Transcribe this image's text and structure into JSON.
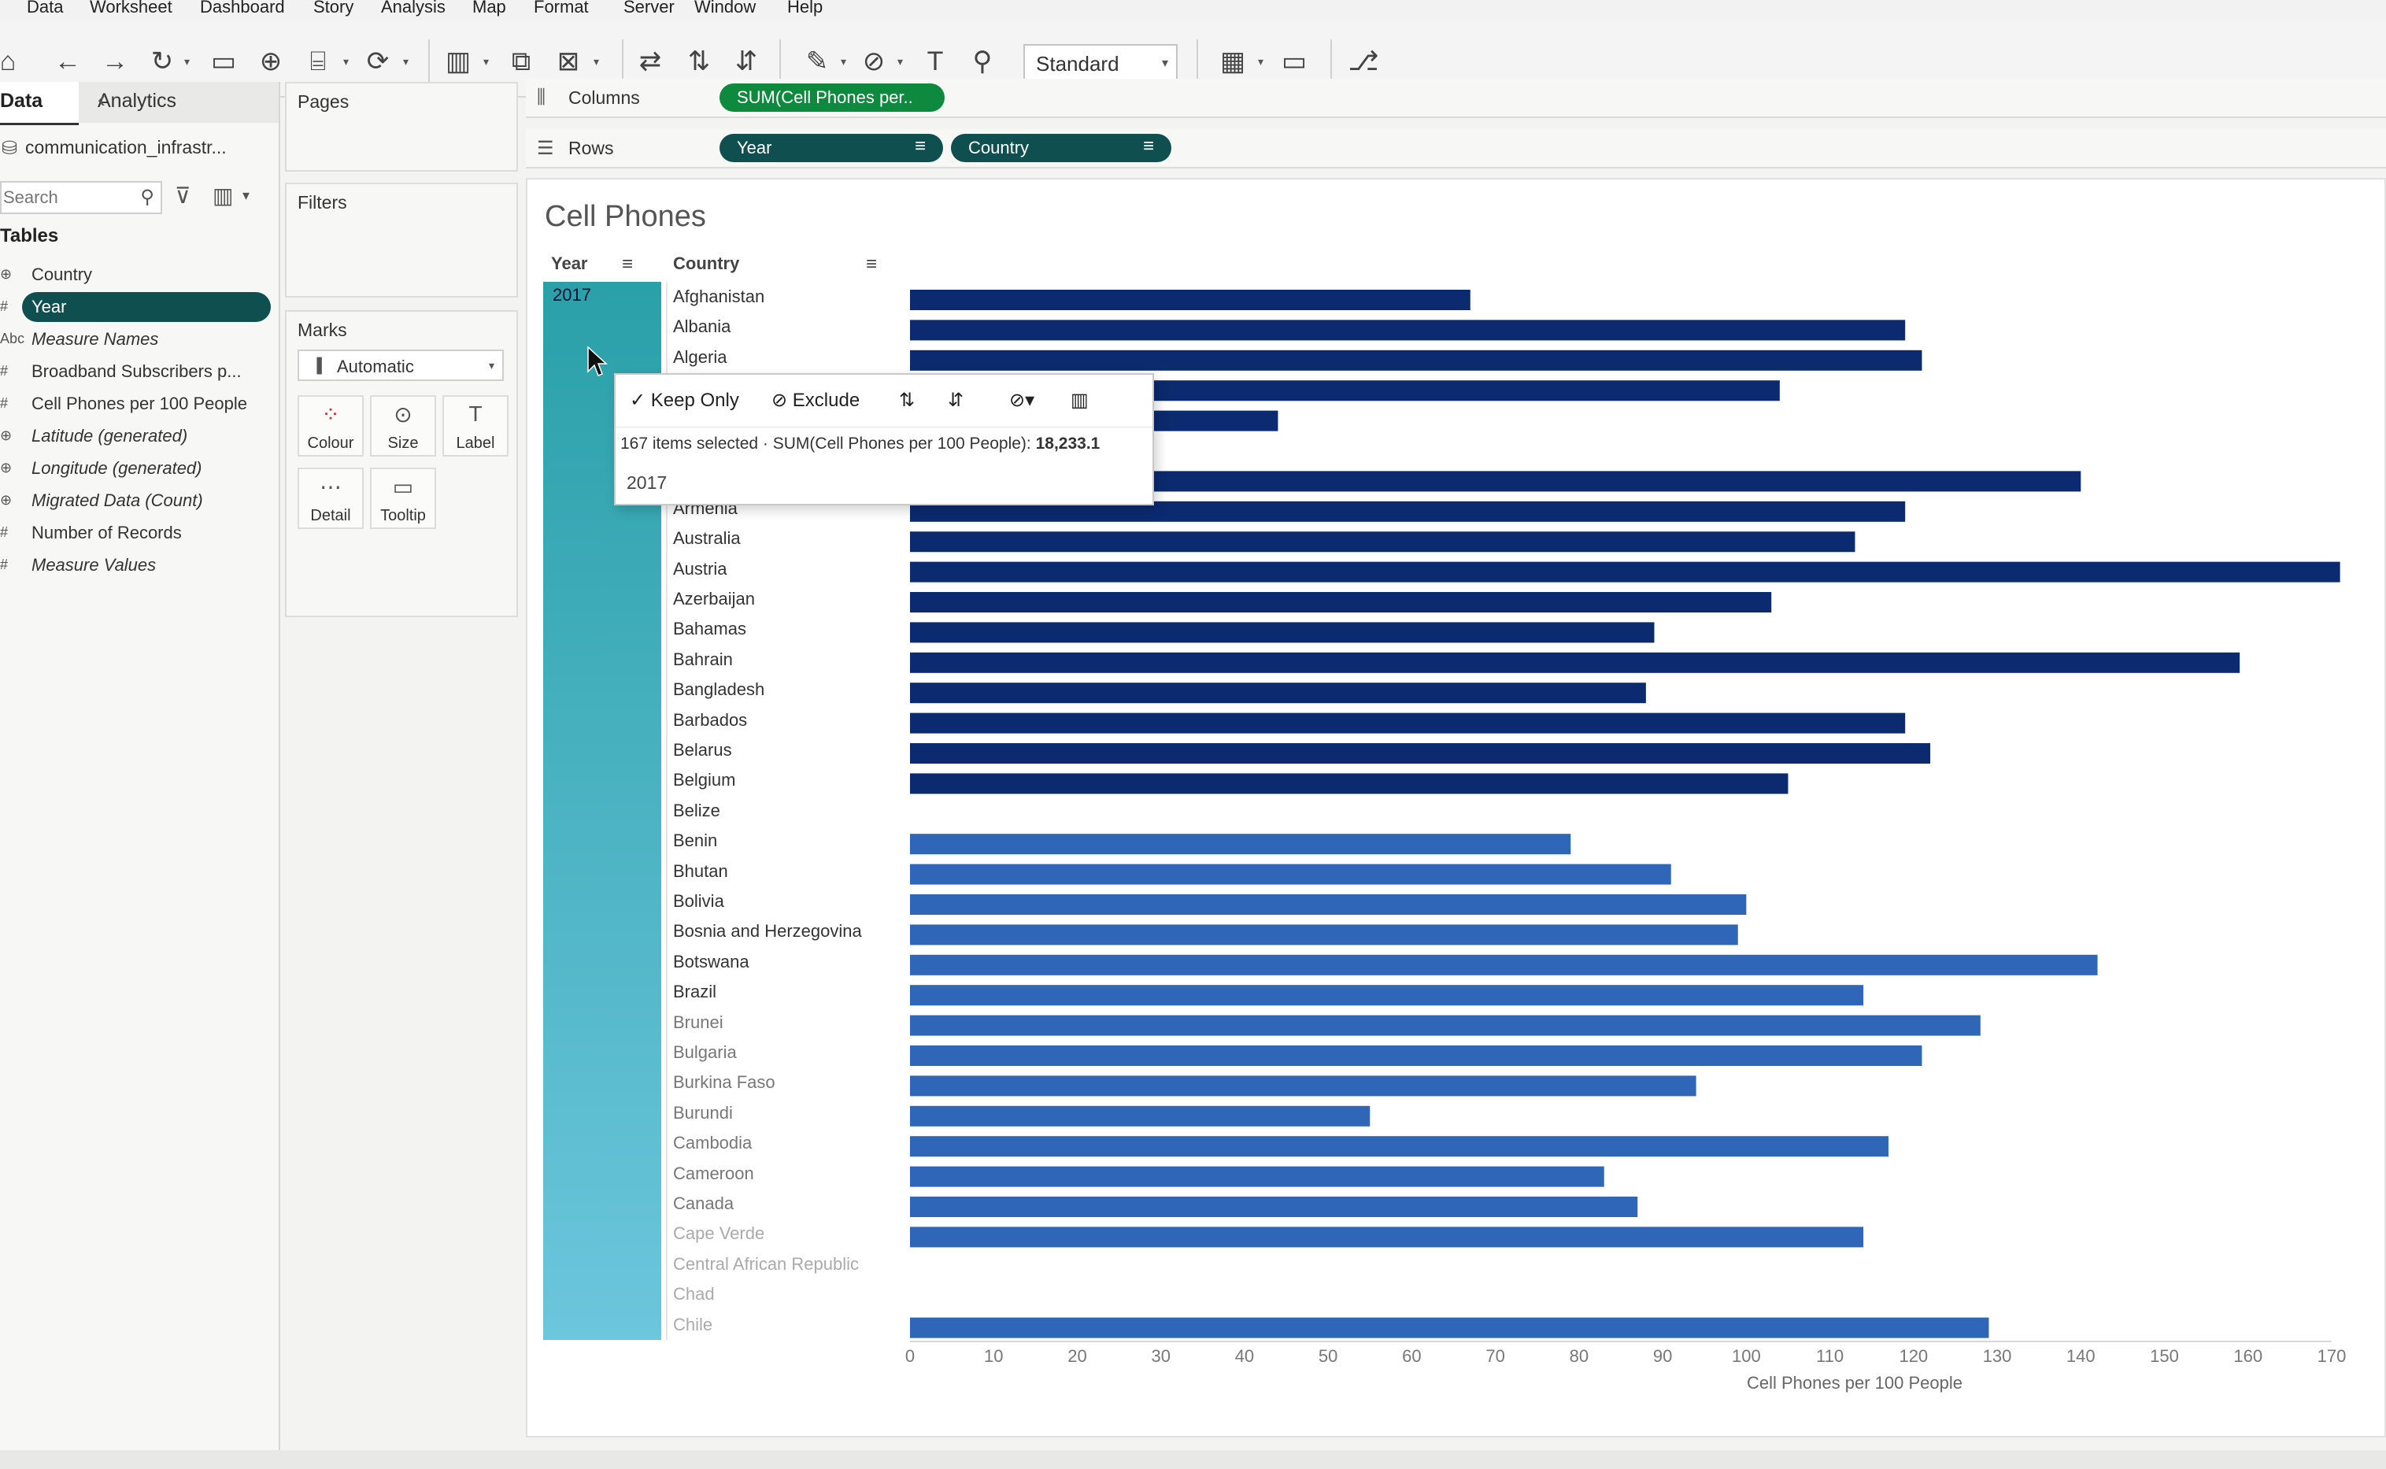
{
  "menu": [
    "Data",
    "Worksheet",
    "Dashboard",
    "Story",
    "Analysis",
    "Map",
    "Format",
    "Server",
    "Window",
    "Help"
  ],
  "toolbar": {
    "standard_label": "Standard"
  },
  "datapane": {
    "tab_data": "Data",
    "tab_analytics": "Analytics",
    "datasource": "communication_infrastr...",
    "search_placeholder": "Search",
    "tables_heading": "Tables",
    "fields": [
      {
        "label": "Country",
        "type": "globe",
        "italic": false,
        "selected": false
      },
      {
        "label": "Year",
        "type": "#",
        "italic": false,
        "selected": true
      },
      {
        "label": "Measure Names",
        "type": "Abc",
        "italic": true,
        "selected": false
      },
      {
        "label": "Broadband Subscribers p...",
        "type": "#",
        "italic": false,
        "selected": false
      },
      {
        "label": "Cell Phones per 100 People",
        "type": "#",
        "italic": false,
        "selected": false
      },
      {
        "label": "Latitude (generated)",
        "type": "globe",
        "italic": true,
        "selected": false
      },
      {
        "label": "Longitude (generated)",
        "type": "globe",
        "italic": true,
        "selected": false
      },
      {
        "label": "Migrated Data (Count)",
        "type": "globe",
        "italic": true,
        "selected": false
      },
      {
        "label": "Number of Records",
        "type": "#",
        "italic": false,
        "selected": false
      },
      {
        "label": "Measure Values",
        "type": "#",
        "italic": true,
        "selected": false
      }
    ]
  },
  "panes": {
    "pages": "Pages",
    "filters": "Filters",
    "marks": "Marks",
    "marks_type": "Automatic",
    "mark_buttons": [
      "Colour",
      "Size",
      "Label",
      "Detail",
      "Tooltip"
    ]
  },
  "shelves": {
    "columns_label": "Columns",
    "rows_label": "Rows",
    "columns_pill": "SUM(Cell Phones per..",
    "rows_pills": [
      "Year",
      "Country"
    ]
  },
  "sheet": {
    "title": "Cell Phones",
    "year_header": "Year",
    "country_header": "Country",
    "year_value": "2017"
  },
  "popup": {
    "keep_only": "Keep Only",
    "exclude": "Exclude",
    "summary_prefix": "167 items selected · SUM(Cell Phones per 100 People):",
    "summary_value": "18,233.1",
    "year": "2017"
  },
  "colors": {
    "bar_dark": "#0b2a6f",
    "bar_light": "#2f66b8",
    "pill_green": "#0d8a3e",
    "pill_teal": "#0f4f50",
    "year_band": "#4bb7c9"
  },
  "chart_data": {
    "type": "bar",
    "orientation": "horizontal",
    "xlabel": "Cell Phones per 100 People",
    "xlim": [
      0,
      170
    ],
    "xticks": [
      0,
      10,
      20,
      30,
      40,
      50,
      60,
      70,
      80,
      90,
      100,
      110,
      120,
      130,
      140,
      150,
      160,
      170
    ],
    "categories": [
      "Afghanistan",
      "Albania",
      "Algeria",
      "",
      "",
      "",
      "",
      "Armenia",
      "Australia",
      "Austria",
      "Azerbaijan",
      "Bahamas",
      "Bahrain",
      "Bangladesh",
      "Barbados",
      "Belarus",
      "Belgium",
      "Belize",
      "Benin",
      "Bhutan",
      "Bolivia",
      "Bosnia and Herzegovina",
      "Botswana",
      "Brazil",
      "Brunei",
      "Bulgaria",
      "Burkina Faso",
      "Burundi",
      "Cambodia",
      "Cameroon",
      "Canada",
      "Cape Verde",
      "Central African Republic",
      "Chad",
      "Chile"
    ],
    "values": [
      67,
      119,
      121,
      104,
      44,
      null,
      140,
      119,
      113,
      171,
      103,
      89,
      159,
      88,
      119,
      122,
      105,
      null,
      79,
      91,
      100,
      99,
      142,
      114,
      128,
      121,
      94,
      55,
      117,
      83,
      87,
      114,
      null,
      null,
      129
    ]
  }
}
